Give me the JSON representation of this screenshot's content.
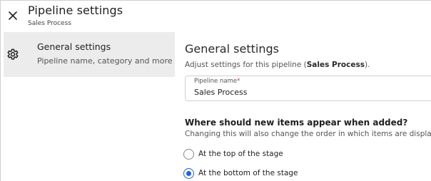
{
  "header": {
    "title": "Pipeline settings",
    "subtitle": "Sales Process",
    "close_icon": "close-icon"
  },
  "sidebar": {
    "items": [
      {
        "icon": "gear-icon",
        "label": "General settings",
        "description": "Pipeline name, category and more",
        "selected": true
      }
    ]
  },
  "main": {
    "title": "General settings",
    "description_prefix": "Adjust settings for this pipeline (",
    "description_bold": "Sales Process",
    "description_suffix": ").",
    "pipeline_name_field": {
      "label": "Pipeline name",
      "required_mark": "*",
      "value": "Sales Process"
    },
    "placement": {
      "question": "Where should new items appear when added?",
      "description": "Changing this will also change the order in which items are displa",
      "options": [
        {
          "label": "At the top of the stage",
          "selected": false
        },
        {
          "label": "At the bottom of the stage",
          "selected": true
        }
      ]
    }
  },
  "colors": {
    "accent": "#1a63e8",
    "sidebar_selected_bg": "#ececec",
    "required": "#dd3333"
  }
}
